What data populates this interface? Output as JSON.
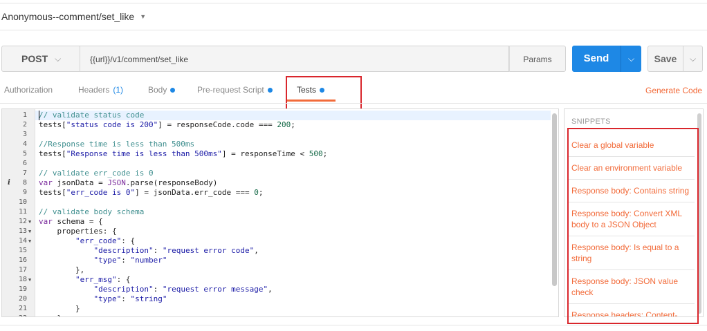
{
  "request": {
    "name": "Anonymous--comment/set_like"
  },
  "urlbar": {
    "method": "POST",
    "url": "{{url}}/v1/comment/set_like",
    "params_label": "Params",
    "send_label": "Send",
    "save_label": "Save"
  },
  "tabs": [
    {
      "label": "Authorization"
    },
    {
      "label": "Headers",
      "count": "(1)"
    },
    {
      "label": "Body",
      "dot": true
    },
    {
      "label": "Pre-request Script",
      "dot": true
    },
    {
      "label": "Tests",
      "dot": true,
      "active": true
    }
  ],
  "generate_code_label": "Generate Code",
  "editor": {
    "lines": [
      {
        "n": "1",
        "code": [
          [
            "c-com",
            "// validate status code"
          ]
        ]
      },
      {
        "n": "2",
        "code": [
          [
            "c-txt",
            "tests["
          ],
          [
            "c-str",
            "\"status code is 200\""
          ],
          [
            "c-txt",
            "] = responseCode.code === "
          ],
          [
            "c-num",
            "200"
          ],
          [
            "c-txt",
            ";"
          ]
        ]
      },
      {
        "n": "3",
        "code": []
      },
      {
        "n": "4",
        "code": [
          [
            "c-com",
            "//Response time is less than 500ms"
          ]
        ]
      },
      {
        "n": "5",
        "code": [
          [
            "c-txt",
            "tests["
          ],
          [
            "c-str",
            "\"Response time is less than 500ms\""
          ],
          [
            "c-txt",
            "] = responseTime < "
          ],
          [
            "c-num",
            "500"
          ],
          [
            "c-txt",
            ";"
          ]
        ]
      },
      {
        "n": "6",
        "code": []
      },
      {
        "n": "7",
        "code": [
          [
            "c-com",
            "// validate err_code is 0"
          ]
        ]
      },
      {
        "n": "8",
        "info": "i",
        "code": [
          [
            "c-kw",
            "var"
          ],
          [
            "c-txt",
            " jsonData = "
          ],
          [
            "c-kw",
            "JSON"
          ],
          [
            "c-txt",
            ".parse(responseBody)"
          ]
        ]
      },
      {
        "n": "9",
        "code": [
          [
            "c-txt",
            "tests["
          ],
          [
            "c-str",
            "\"err_code is 0\""
          ],
          [
            "c-txt",
            "] = jsonData.err_code === "
          ],
          [
            "c-num",
            "0"
          ],
          [
            "c-txt",
            ";"
          ]
        ]
      },
      {
        "n": "10",
        "code": []
      },
      {
        "n": "11",
        "code": [
          [
            "c-com",
            "// validate body schema"
          ]
        ]
      },
      {
        "n": "12",
        "fold": true,
        "code": [
          [
            "c-kw",
            "var"
          ],
          [
            "c-txt",
            " schema = {"
          ]
        ]
      },
      {
        "n": "13",
        "fold": true,
        "code": [
          [
            "c-txt",
            "    properties: {"
          ]
        ]
      },
      {
        "n": "14",
        "fold": true,
        "code": [
          [
            "c-prop",
            "        \"err_code\""
          ],
          [
            "c-txt",
            ": {"
          ]
        ]
      },
      {
        "n": "15",
        "code": [
          [
            "c-prop",
            "            \"description\""
          ],
          [
            "c-txt",
            ": "
          ],
          [
            "c-str",
            "\"request error code\""
          ],
          [
            "c-txt",
            ","
          ]
        ]
      },
      {
        "n": "16",
        "code": [
          [
            "c-prop",
            "            \"type\""
          ],
          [
            "c-txt",
            ": "
          ],
          [
            "c-str",
            "\"number\""
          ]
        ]
      },
      {
        "n": "17",
        "code": [
          [
            "c-txt",
            "        },"
          ]
        ]
      },
      {
        "n": "18",
        "fold": true,
        "code": [
          [
            "c-prop",
            "        \"err_msg\""
          ],
          [
            "c-txt",
            ": {"
          ]
        ]
      },
      {
        "n": "19",
        "code": [
          [
            "c-prop",
            "            \"description\""
          ],
          [
            "c-txt",
            ": "
          ],
          [
            "c-str",
            "\"request error message\""
          ],
          [
            "c-txt",
            ","
          ]
        ]
      },
      {
        "n": "20",
        "code": [
          [
            "c-prop",
            "            \"type\""
          ],
          [
            "c-txt",
            ": "
          ],
          [
            "c-str",
            "\"string\""
          ]
        ]
      },
      {
        "n": "21",
        "code": [
          [
            "c-txt",
            "        }"
          ]
        ]
      },
      {
        "n": "22",
        "code": [
          [
            "c-txt",
            "    }"
          ]
        ]
      }
    ]
  },
  "snippets": {
    "title": "SNIPPETS",
    "items": [
      "Clear a global variable",
      "Clear an environment variable",
      "Response body: Contains string",
      "Response body: Convert XML body to a JSON Object",
      "Response body: Is equal to a string",
      "Response body: JSON value check",
      "Response headers: Content-"
    ]
  }
}
